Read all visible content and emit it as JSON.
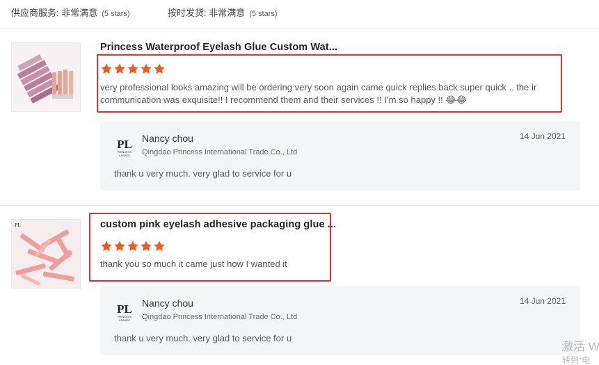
{
  "summary": {
    "supplier_service_label": "供应商服务: 非常满意",
    "supplier_service_stars": "(5 stars)",
    "on_time_label": "按时发货: 非常满意",
    "on_time_stars": "(5 stars)"
  },
  "reviews": [
    {
      "title": "Princess Waterproof Eyelash Glue Custom Wat...",
      "rating": 5,
      "comment": "very professional looks amazing will be ordering very soon again came quick replies back super quick .. the ir communication was exquisite!! I recommend them and their services !! I’m so happy !! 😂😂",
      "reply": {
        "name": "Nancy chou",
        "company": "Qingdao Princess International Trade Co., Ltd",
        "date": "14 Jun 2021",
        "text": "thank u very much.  very glad to service for u"
      }
    },
    {
      "title": "custom pink eyelash adhesive packaging glue ...",
      "rating": 5,
      "comment": "thank you so much it came just how I wanted it",
      "reply": {
        "name": "Nancy chou",
        "company": "Qingdao Princess International Trade Co., Ltd",
        "date": "14 Jun 2021",
        "text": "thank u very much.  very glad to service for u"
      }
    }
  ],
  "colors": {
    "star": "#f05a1a",
    "highlight": "#e0302f",
    "reply_bg": "#f4f5f7"
  },
  "watermark": {
    "line1": "激活 W",
    "line2": "转到“电"
  }
}
